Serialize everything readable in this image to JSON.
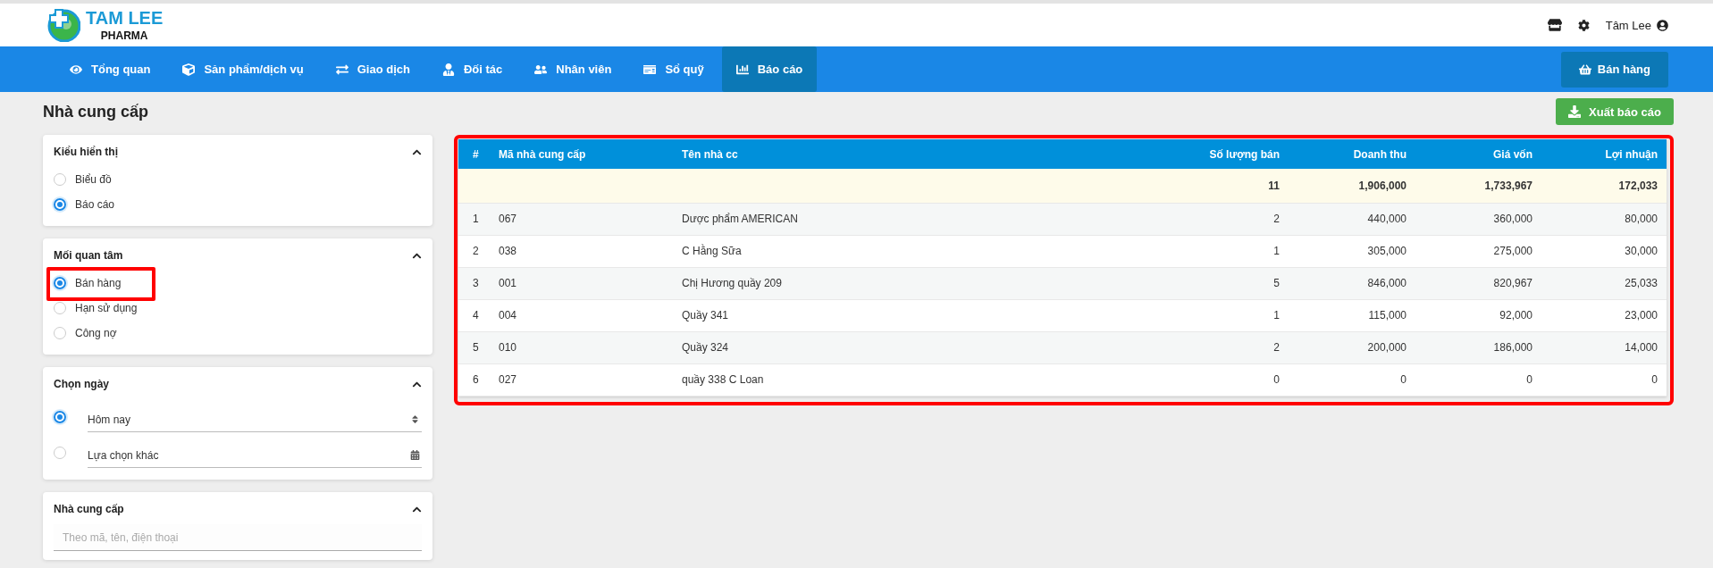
{
  "brand": {
    "name": "TAM LEE",
    "tagline": "PHARMA"
  },
  "user": {
    "name": "Tâm Lee"
  },
  "nav": [
    {
      "label": "Tổng quan",
      "selected": false
    },
    {
      "label": "Sản phẩm/dịch vụ",
      "selected": false
    },
    {
      "label": "Giao dịch",
      "selected": false
    },
    {
      "label": "Đối tác",
      "selected": false
    },
    {
      "label": "Nhân viên",
      "selected": false
    },
    {
      "label": "Sổ quỹ",
      "selected": false
    },
    {
      "label": "Báo cáo",
      "selected": true
    }
  ],
  "sell_button": "Bán hàng",
  "page_title": "Nhà cung cấp",
  "export_button": "Xuất báo cáo",
  "filters": [
    {
      "title": "Kiểu hiển thị",
      "kind": "radio",
      "options": [
        {
          "label": "Biểu đồ",
          "selected": false,
          "highlighted": false
        },
        {
          "label": "Báo cáo",
          "selected": true,
          "highlighted": false
        }
      ]
    },
    {
      "title": "Mối quan tâm",
      "kind": "radio",
      "options": [
        {
          "label": "Bán hàng",
          "selected": true,
          "highlighted": true
        },
        {
          "label": "Hạn sử dụng",
          "selected": false,
          "highlighted": false
        },
        {
          "label": "Công nợ",
          "selected": false,
          "highlighted": false
        }
      ]
    },
    {
      "title": "Chọn ngày",
      "kind": "date",
      "options": [
        {
          "label": "Hôm nay",
          "selected": true
        },
        {
          "label": "Lựa chọn khác",
          "selected": false
        }
      ]
    },
    {
      "title": "Nhà cung cấp",
      "kind": "search",
      "placeholder": "Theo mã, tên, điện thoại"
    }
  ],
  "table": {
    "highlighted": true,
    "columns": [
      "#",
      "Mã nhà cung cấp",
      "Tên nhà cc",
      "Số lượng bán",
      "Doanh thu",
      "Giá vốn",
      "Lợi nhuận"
    ],
    "totals": [
      "11",
      "1,906,000",
      "1,733,967",
      "172,033"
    ],
    "rows": [
      [
        "1",
        "067",
        "Dược phẩm AMERICAN",
        "2",
        "440,000",
        "360,000",
        "80,000"
      ],
      [
        "2",
        "038",
        "C Hằng Sữa",
        "1",
        "305,000",
        "275,000",
        "30,000"
      ],
      [
        "3",
        "001",
        "Chị Hương quầy 209",
        "5",
        "846,000",
        "820,967",
        "25,033"
      ],
      [
        "4",
        "004",
        "Quầy 341",
        "1",
        "115,000",
        "92,000",
        "23,000"
      ],
      [
        "5",
        "010",
        "Quầy 324",
        "2",
        "200,000",
        "186,000",
        "14,000"
      ],
      [
        "6",
        "027",
        "quầy 338 C Loan",
        "0",
        "0",
        "0",
        "0"
      ]
    ]
  }
}
